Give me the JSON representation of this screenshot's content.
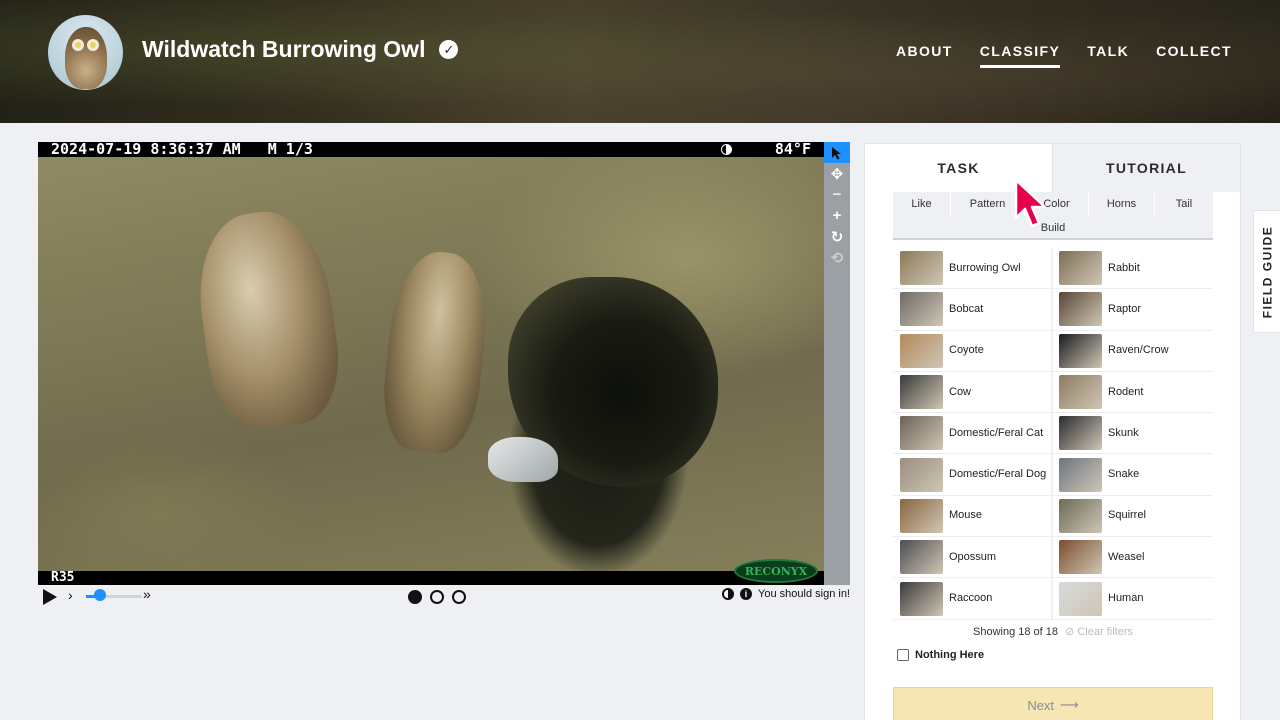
{
  "project": {
    "title": "Wildwatch Burrowing Owl",
    "verified_icon": "check-circle-icon"
  },
  "nav": {
    "items": [
      {
        "label": "ABOUT",
        "active": false
      },
      {
        "label": "CLASSIFY",
        "active": true
      },
      {
        "label": "TALK",
        "active": false
      },
      {
        "label": "COLLECT",
        "active": false
      }
    ]
  },
  "subject": {
    "timestamp": "2024-07-19 8:36:37 AM   M 1/3",
    "temperature": "84°F",
    "camera_id": "R35",
    "brand_logo": "RECONYX"
  },
  "viewer_tools": [
    "pointer-icon",
    "move-icon",
    "zoom-out-icon",
    "zoom-in-icon",
    "rotate-icon",
    "reset-icon"
  ],
  "controls": {
    "frames": 3,
    "current_frame": 1,
    "sign_in_text": "You should sign in!",
    "speed_fraction": 0.25
  },
  "panel": {
    "tabs": {
      "task": "TASK",
      "tutorial": "TUTORIAL"
    },
    "filters": [
      "Like",
      "Pattern",
      "Color",
      "Horns",
      "Tail",
      "Build"
    ],
    "choices": [
      {
        "name": "Burrowing Owl",
        "color": "#8b7a58"
      },
      {
        "name": "Rabbit",
        "color": "#7d6f55"
      },
      {
        "name": "Bobcat",
        "color": "#6f6a66"
      },
      {
        "name": "Raptor",
        "color": "#5a4637"
      },
      {
        "name": "Coyote",
        "color": "#b38a5c"
      },
      {
        "name": "Raven/Crow",
        "color": "#1c1c1f"
      },
      {
        "name": "Cow",
        "color": "#3a3a3a"
      },
      {
        "name": "Rodent",
        "color": "#8e7a62"
      },
      {
        "name": "Domestic/Feral Cat",
        "color": "#6e6258"
      },
      {
        "name": "Skunk",
        "color": "#2a2a2e"
      },
      {
        "name": "Domestic/Feral Dog",
        "color": "#9a8e80"
      },
      {
        "name": "Snake",
        "color": "#6d7580"
      },
      {
        "name": "Mouse",
        "color": "#8a6540"
      },
      {
        "name": "Squirrel",
        "color": "#6b6a58"
      },
      {
        "name": "Opossum",
        "color": "#4d4d50"
      },
      {
        "name": "Weasel",
        "color": "#7a4e2c"
      },
      {
        "name": "Raccoon",
        "color": "#3b3a3c"
      },
      {
        "name": "Human",
        "color": "#d7dadc"
      }
    ],
    "showing_text": "Showing 18 of 18",
    "clear_filters": "Clear filters",
    "nothing_here": "Nothing Here",
    "next": "Next"
  },
  "field_guide": "FIELD GUIDE",
  "colors": {
    "accent": "#1e90ff",
    "cursor": "#e6004c",
    "next_bg": "#f5e6b3"
  }
}
